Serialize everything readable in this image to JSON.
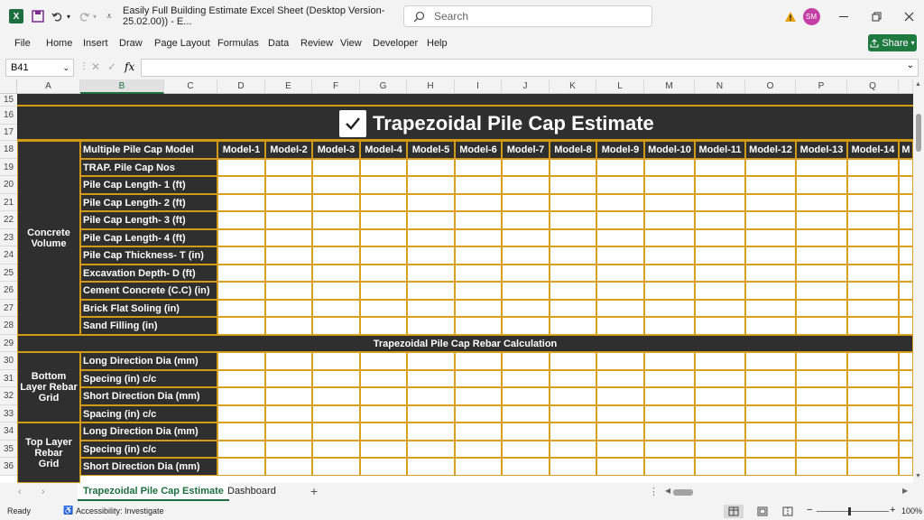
{
  "title": "Easily Full Building Estimate Excel Sheet (Desktop Version-25.02.00)) - E...",
  "search_placeholder": "Search",
  "user_initials": "SM",
  "menu": [
    "File",
    "Home",
    "Insert",
    "Draw",
    "Page Layout",
    "Formulas",
    "Data",
    "Review",
    "View",
    "Developer",
    "Help"
  ],
  "share_label": "Share",
  "name_box": "B41",
  "fx": "fx",
  "columns": [
    "A",
    "B",
    "C",
    "D",
    "E",
    "F",
    "G",
    "H",
    "I",
    "J",
    "K",
    "L",
    "M",
    "N",
    "O",
    "P",
    "Q"
  ],
  "rows": [
    "15",
    "16",
    "17",
    "18",
    "19",
    "20",
    "21",
    "22",
    "23",
    "24",
    "25",
    "26",
    "27",
    "28",
    "29",
    "30",
    "31",
    "32",
    "33",
    "34",
    "35",
    "36"
  ],
  "estimate_title": "Trapezoidal Pile Cap Estimate",
  "header_label": "Multiple Pile Cap Model",
  "models": [
    "Model-1",
    "Model-2",
    "Model-3",
    "Model-4",
    "Model-5",
    "Model-6",
    "Model-7",
    "Model-8",
    "Model-9",
    "Model-10",
    "Model-11",
    "Model-12",
    "Model-13",
    "Model-14",
    "M"
  ],
  "concrete_group": "Concrete Volume",
  "concrete_items": [
    "TRAP. Pile Cap Nos",
    "Pile Cap Length- 1 (ft)",
    "Pile Cap Length- 2 (ft)",
    "Pile Cap Length- 3 (ft)",
    "Pile Cap Length- 4 (ft)",
    "Pile Cap Thickness- T (in)",
    "Excavation Depth- D (ft)",
    "Cement Concrete (C.C) (in)",
    "Brick Flat Soling (in)",
    "Sand Filling (in)"
  ],
  "rebar_title": "Trapezoidal Pile Cap Rebar Calculation",
  "bottom_group": "Bottom Layer Rebar Grid",
  "bottom_items": [
    "Long Direction Dia (mm)",
    "Specing (in) c/c",
    "Short Direction Dia (mm)",
    "Spacing (in) c/c"
  ],
  "top_group": "Top Layer Rebar Grid",
  "top_items": [
    "Long Direction Dia (mm)",
    "Specing (in) c/c",
    "Short Direction Dia (mm)"
  ],
  "sheet_tabs": [
    "Trapezoidal Pile Cap Estimate",
    "Dashboard"
  ],
  "status_ready": "Ready",
  "status_accessibility": "Accessibility: Investigate",
  "zoom": "100%"
}
